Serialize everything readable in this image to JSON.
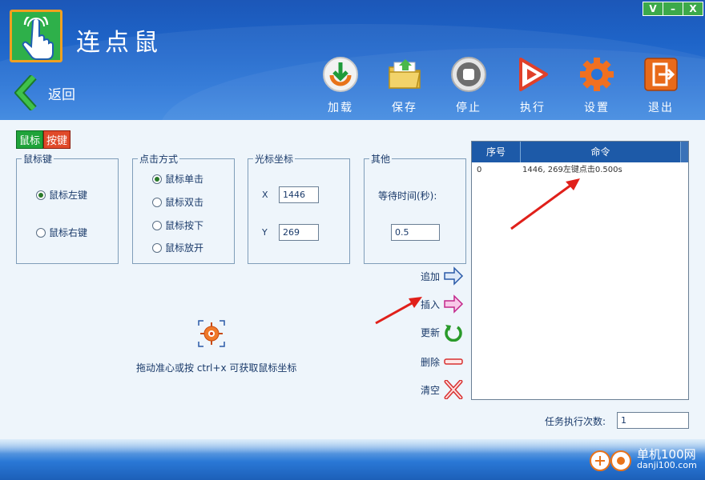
{
  "app": {
    "title": "连点鼠",
    "window_controls": [
      "V",
      "–",
      "X"
    ]
  },
  "nav": {
    "back_label": "返回"
  },
  "toolbar": [
    {
      "label": "加载",
      "icon": "download-icon"
    },
    {
      "label": "保存",
      "icon": "folder-icon"
    },
    {
      "label": "停止",
      "icon": "stop-icon"
    },
    {
      "label": "执行",
      "icon": "play-icon"
    },
    {
      "label": "设置",
      "icon": "gear-icon"
    },
    {
      "label": "退出",
      "icon": "exit-icon"
    }
  ],
  "mode_tag": {
    "part1": "鼠标",
    "part2": "按键"
  },
  "mouse_key": {
    "legend": "鼠标键",
    "options": [
      "鼠标左键",
      "鼠标右键"
    ],
    "selected": 0
  },
  "click_mode": {
    "legend": "点击方式",
    "options": [
      "鼠标单击",
      "鼠标双击",
      "鼠标按下",
      "鼠标放开"
    ],
    "selected": 0
  },
  "cursor_coords": {
    "legend": "光标坐标",
    "x_label": "X",
    "x_value": "1446",
    "y_label": "Y",
    "y_value": "269"
  },
  "other": {
    "legend": "其他",
    "wait_label": "等待时间(秒):",
    "wait_value": "0.5"
  },
  "actions": [
    {
      "label": "追加",
      "icon": "arrow-right-blue-icon"
    },
    {
      "label": "插入",
      "icon": "arrow-right-pink-icon"
    },
    {
      "label": "更新",
      "icon": "refresh-icon"
    },
    {
      "label": "删除",
      "icon": "minus-icon"
    },
    {
      "label": "清空",
      "icon": "clear-x-icon"
    }
  ],
  "picker": {
    "hint": "拖动准心或按 ctrl+x 可获取鼠标坐标"
  },
  "command_list": {
    "headers": [
      "序号",
      "命令"
    ],
    "rows": [
      {
        "index": "0",
        "command": "1446, 269左键点击0.500s"
      }
    ]
  },
  "run_count": {
    "label": "任务执行次数:",
    "value": "1"
  },
  "watermark": {
    "site_cn": "单机100网",
    "site_url": "danji100.com"
  },
  "colors": {
    "header_blue": "#1e64c8",
    "list_header": "#1d5aa8",
    "accent_green": "#2eb04a",
    "arrow_red": "#e0201a"
  }
}
